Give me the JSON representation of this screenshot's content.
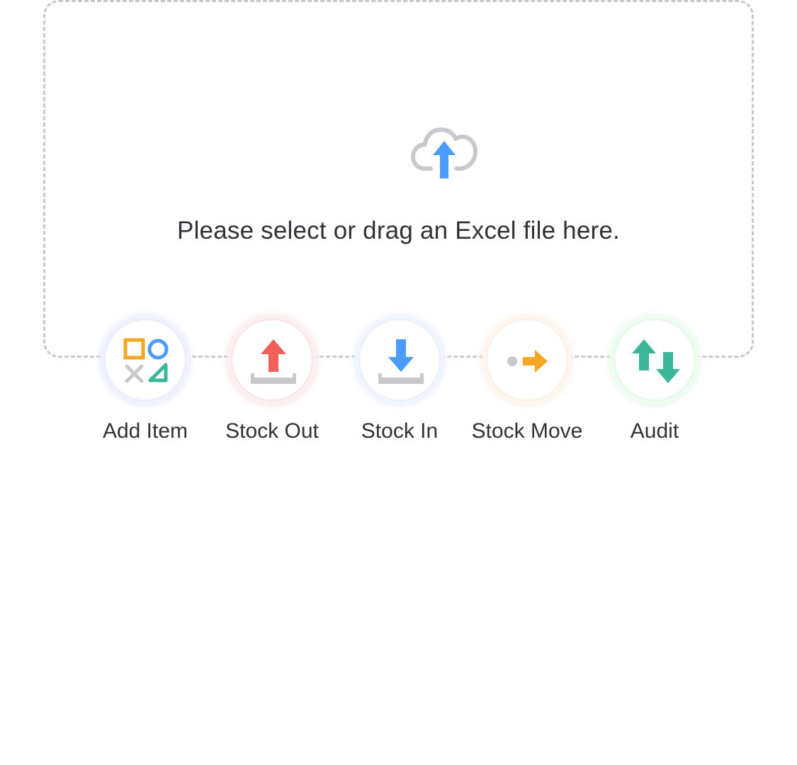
{
  "upload": {
    "icon": "cloud-upload-icon",
    "hint": "Please select or drag an Excel file here."
  },
  "actions": [
    {
      "label": "Add Item",
      "icon": "shapes-icon",
      "accent": "#f5a623"
    },
    {
      "label": "Stock Out",
      "icon": "stock-out-icon",
      "accent": "#f2605c"
    },
    {
      "label": "Stock In",
      "icon": "stock-in-icon",
      "accent": "#4b9dfb"
    },
    {
      "label": "Stock Move",
      "icon": "stock-move-icon",
      "accent": "#f5a623"
    },
    {
      "label": "Audit",
      "icon": "audit-arrows-icon",
      "accent": "#3ab79a"
    }
  ],
  "colors": {
    "border_dashed": "#c9c9cc",
    "text": "#2f3338",
    "gray_icon": "#c8c9ce",
    "blue": "#4b9dfb",
    "red": "#f2605c",
    "orange": "#f5a623",
    "teal": "#3ab79a"
  }
}
